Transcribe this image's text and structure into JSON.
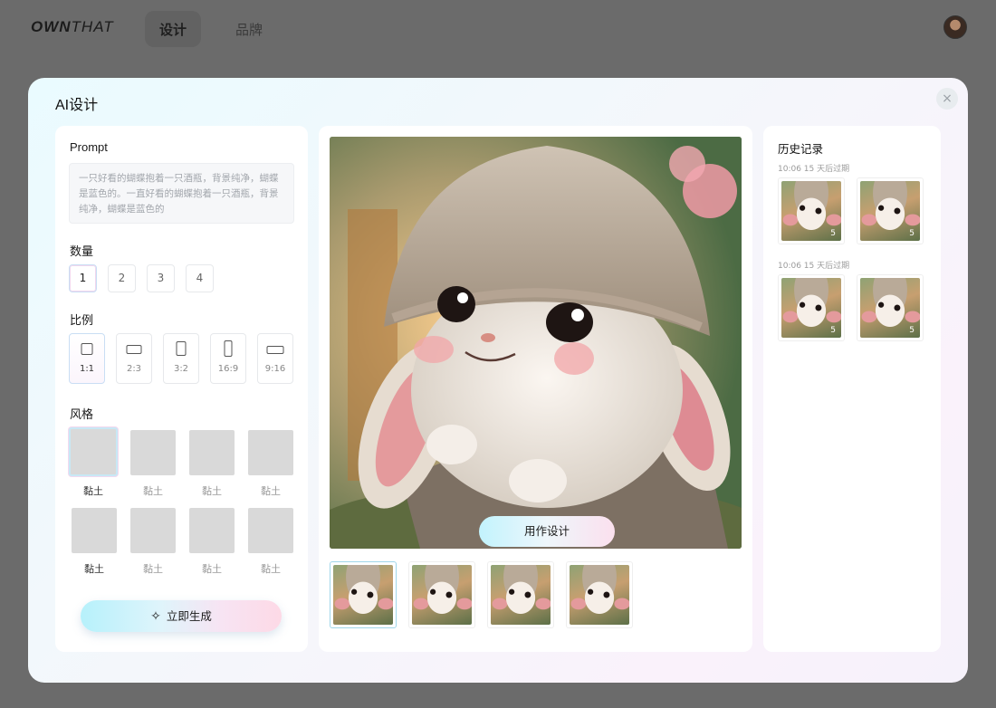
{
  "nav": {
    "logo_bold": "OWN",
    "logo_light": "THAT",
    "items": [
      {
        "label": "设计",
        "active": true
      },
      {
        "label": "品牌",
        "active": false
      }
    ]
  },
  "modal": {
    "title": "AI设计",
    "close_icon": "×"
  },
  "left": {
    "prompt_label": "Prompt",
    "prompt_text": "一只好看的蝴蝶抱着一只酒瓶，背景纯净，蝴蝶是蓝色的。一直好看的蝴蝶抱着一只酒瓶，背景纯净，蝴蝶是蓝色的",
    "count_label": "数量",
    "counts": [
      "1",
      "2",
      "3",
      "4"
    ],
    "count_selected": "1",
    "ratio_label": "比例",
    "ratios": [
      "1:1",
      "2:3",
      "3:2",
      "16:9",
      "9:16"
    ],
    "ratio_selected": "1:1",
    "style_label": "风格",
    "styles": [
      "黏土",
      "黏土",
      "黏土",
      "黏土",
      "黏土",
      "黏土",
      "黏土",
      "黏土"
    ],
    "generate_label": "立即生成",
    "generate_icon": "sparkle-icon"
  },
  "center": {
    "use_label": "用作设计",
    "thumb_count": 4,
    "thumb_selected": 0
  },
  "history": {
    "title": "历史记录",
    "groups": [
      {
        "meta": "10:06 15 天后过期",
        "items": [
          "5",
          "5"
        ]
      },
      {
        "meta": "10:06 15 天后过期",
        "items": [
          "5",
          "5"
        ]
      }
    ]
  },
  "colors": {
    "accent_cyan": "#b6f1fb",
    "accent_pink": "#fdd9e6",
    "overlay": "#6b6b6b"
  }
}
